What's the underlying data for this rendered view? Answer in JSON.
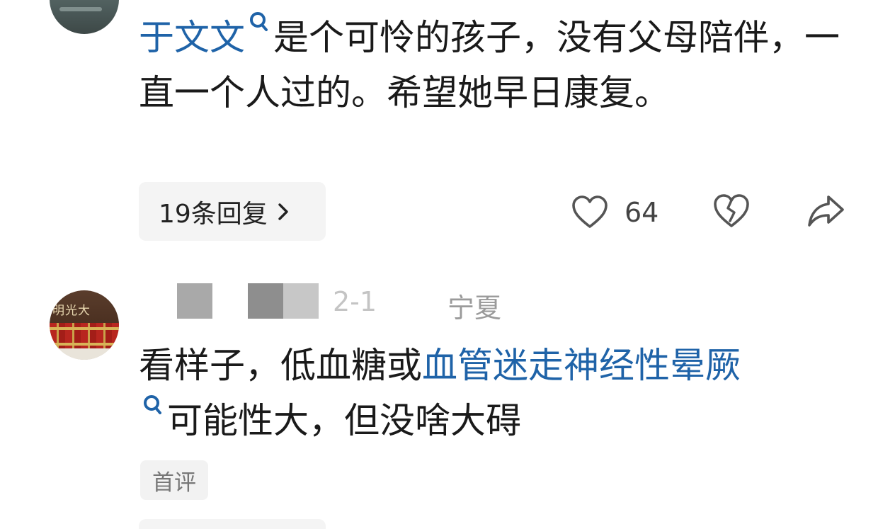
{
  "comments": [
    {
      "text_segments": [
        {
          "text": "于文文",
          "link": true,
          "search_icon": true
        },
        {
          "text": "是个可怜的孩子，没有父母陪伴，一直一个人过的。希望她早日康复。",
          "link": false
        }
      ],
      "replies_label": "19条回复",
      "likes": "64"
    },
    {
      "meta_partial": "2-1",
      "location": "宁夏",
      "avatar_sign_text": "明光大",
      "text_segments": [
        {
          "text": "看样子，低血糖或",
          "link": false
        },
        {
          "text": "血管迷走神经性晕厥",
          "link": true,
          "search_icon": true
        },
        {
          "text": "可能性大，但没啥大碍",
          "link": false
        }
      ],
      "tag": "首评"
    }
  ],
  "colors": {
    "link": "#1f63a8",
    "text": "#1a1a1a",
    "secondary": "#9a9a9a",
    "pill_bg": "#f4f4f4"
  },
  "icons": [
    "search-icon",
    "heart-icon",
    "broken-heart-icon",
    "share-icon",
    "chevron-right-icon"
  ]
}
